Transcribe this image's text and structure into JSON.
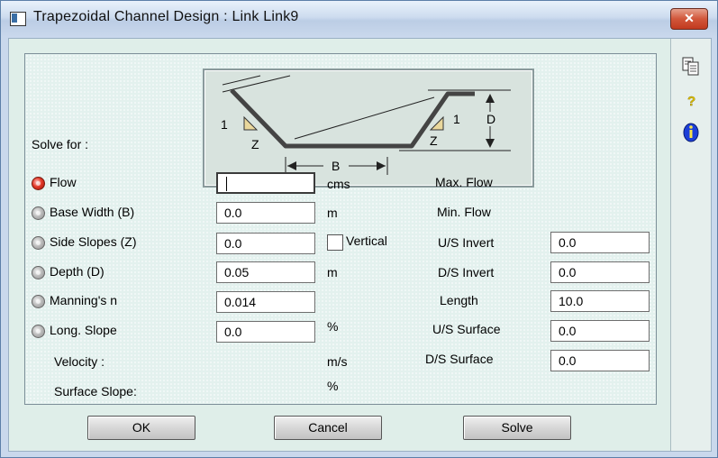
{
  "window": {
    "title": "Trapezoidal Channel Design : Link Link9",
    "close_label": "✕"
  },
  "diagram": {
    "slope_label_1": "1",
    "slope_label_z": "Z",
    "depth_label": "D",
    "base_label": "B"
  },
  "solve_for_label": "Solve for :",
  "fields": [
    {
      "label": "Flow",
      "value": "",
      "unit": "cms",
      "selected": true
    },
    {
      "label": "Base Width (B)",
      "value": "0.0",
      "unit": "m",
      "selected": false
    },
    {
      "label": "Side Slopes (Z)",
      "value": "0.0",
      "unit": "",
      "selected": false
    },
    {
      "label": "Depth (D)",
      "value": "0.05",
      "unit": "m",
      "selected": false
    },
    {
      "label": "Manning's n",
      "value": "0.014",
      "unit": "",
      "selected": false
    },
    {
      "label": "Long. Slope",
      "value": "0.0",
      "unit": "%",
      "selected": false
    }
  ],
  "vertical_label": "Vertical",
  "vertical_checked": false,
  "results": {
    "velocity_label": "Velocity :",
    "velocity_unit": "m/s",
    "surface_slope_label": "Surface Slope:",
    "surface_slope_unit": "%"
  },
  "right_labels": {
    "max_flow": "Max. Flow",
    "min_flow": "Min. Flow",
    "us_invert": "U/S Invert",
    "ds_invert": "D/S Invert",
    "length": "Length",
    "us_surface": "U/S Surface",
    "ds_surface": "D/S Surface"
  },
  "right_values": {
    "us_invert": "0.0",
    "ds_invert": "0.0",
    "length": "10.0",
    "us_surface": "0.0",
    "ds_surface": "0.0"
  },
  "buttons": {
    "ok": "OK",
    "cancel": "Cancel",
    "solve": "Solve"
  },
  "sidebar_icons": [
    "copy-icon",
    "help-icon",
    "info-icon"
  ],
  "colors": {
    "selected_radio": "#e43a2a",
    "close_button": "#c23a1f",
    "info_icon": "#1c3fd8"
  }
}
